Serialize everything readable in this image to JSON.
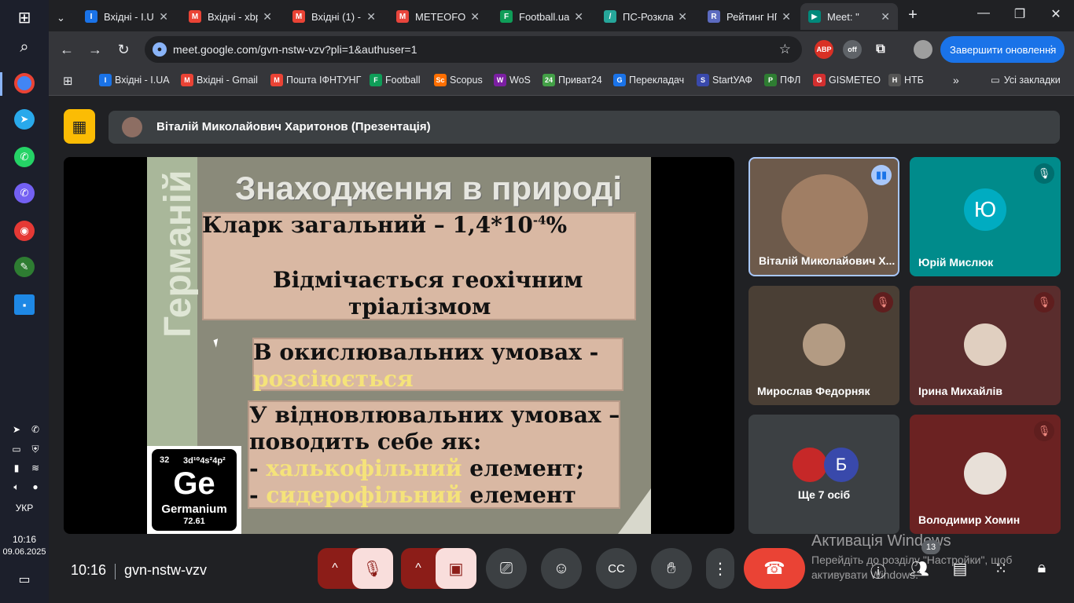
{
  "taskbar": {
    "language": "УКР",
    "time": "10:16",
    "date": "09.06.2025"
  },
  "tabs": [
    {
      "title": "Вхідні - I.UA",
      "icon": "iua-icon",
      "color": "#1a73e8",
      "fav": "I"
    },
    {
      "title": "Вхідні - xbp",
      "icon": "gmail-icon",
      "color": "#ea4335",
      "fav": "M"
    },
    {
      "title": "Вхідні (1) -",
      "icon": "gmail-icon",
      "color": "#ea4335",
      "fav": "M"
    },
    {
      "title": "METEOFOR",
      "icon": "meteofor-icon",
      "color": "#e8453c",
      "fav": "M"
    },
    {
      "title": "Football.ua",
      "icon": "football-icon",
      "color": "#0f9d58",
      "fav": "F"
    },
    {
      "title": "ПС-Розкла",
      "icon": "schedule-icon",
      "color": "#26a69a",
      "fav": "/"
    },
    {
      "title": "Рейтинг НП",
      "icon": "rating-icon",
      "color": "#5c6bc0",
      "fav": "R"
    },
    {
      "title": "Meet: \"",
      "icon": "meet-icon",
      "color": "#00897b",
      "fav": "▶"
    }
  ],
  "address": {
    "url": "meet.google.com/gvn-nstw-vzv?pli=1&authuser=1",
    "update_label": "Завершити оновлення"
  },
  "bookmarks": [
    {
      "label": "Вхідні - I.UA",
      "color": "#1a73e8",
      "fav": "I"
    },
    {
      "label": "Вхідні - Gmail",
      "color": "#ea4335",
      "fav": "M"
    },
    {
      "label": "Пошта ІФНТУНГ",
      "color": "#ea4335",
      "fav": "M"
    },
    {
      "label": "Football",
      "color": "#0f9d58",
      "fav": "F"
    },
    {
      "label": "Scopus",
      "color": "#ff6f00",
      "fav": "Sc"
    },
    {
      "label": "WoS",
      "color": "#7b1fa2",
      "fav": "W"
    },
    {
      "label": "Приват24",
      "color": "#43a047",
      "fav": "24"
    },
    {
      "label": "Перекладач",
      "color": "#1a73e8",
      "fav": "G"
    },
    {
      "label": "StartУАФ",
      "color": "#3949ab",
      "fav": "S"
    },
    {
      "label": "ПФЛ",
      "color": "#2e7d32",
      "fav": "P"
    },
    {
      "label": "GISMETEO",
      "color": "#d32f2f",
      "fav": "G"
    },
    {
      "label": "НТБ",
      "color": "#555555",
      "fav": "H"
    }
  ],
  "bookmarks_all": "Усі закладки",
  "meet": {
    "presenter": "Віталій Миколайович Харитонов (Презентація)",
    "slide": {
      "vertical": "Германій",
      "title": "Знаходження в природі",
      "box1_line1": "Кларк загальний – 1,4*10",
      "box1_exp": "-4",
      "box1_unit": "%",
      "box1_line2": "Відмічається геохічним",
      "box1_line3": "тріалізмом",
      "box2_line1": "В окислювальних умовах -",
      "box2_line2": "розсіюється",
      "box3_line1": "У відновлювальних умовах –",
      "box3_line2": "поводить себе як:",
      "box3_item1_dash": "- ",
      "box3_item1_hl": "халькофільний",
      "box3_item1_rest": " елемент;",
      "box3_item2_dash": "- ",
      "box3_item2_hl": "сидерофільний",
      "box3_item2_rest": " елемент",
      "element_number": "32",
      "element_config": "3d¹⁰4s²4p²",
      "element_symbol": "Ge",
      "element_name": "Germanium",
      "element_mass": "72.61"
    },
    "tiles": [
      {
        "name": "Віталій Миколайович Х...",
        "avatar": "",
        "color": "#6d5a4b"
      },
      {
        "name": "Юрій Мислюк",
        "avatar": "Ю",
        "color": "#00838f"
      },
      {
        "name": "Мирослав Федорняк",
        "avatar": "",
        "color": "#a1887f"
      },
      {
        "name": "Ірина Михайлів",
        "avatar": "",
        "color": "#bcaaa4"
      },
      {
        "name": "Ще 7 осіб",
        "avatar": "Б",
        "color": "#3949ab"
      },
      {
        "name": "Володимир Хомин",
        "avatar": "",
        "color": "#8d6e63"
      }
    ],
    "clock": "10:16",
    "code": "gvn-nstw-vzv",
    "people_count": "13",
    "win_activate_title": "Активація Windows",
    "win_activate_text": "Перейдіть до розділу \"Настройки\", щоб активувати Windows."
  }
}
